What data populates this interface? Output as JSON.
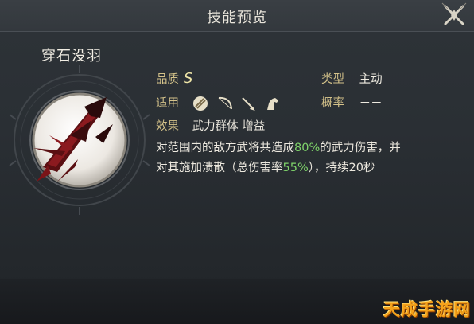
{
  "header": {
    "title": "技能预览"
  },
  "skill": {
    "name": "穿石没羽",
    "quality_label": "品质",
    "quality_value": "S",
    "type_label": "类型",
    "type_value": "主动",
    "suitable_label": "适用",
    "suitable_icons": [
      "cavalry-shield-icon",
      "bow-icon",
      "spear-icon",
      "horse-icon"
    ],
    "chance_label": "概率",
    "chance_value": "－－",
    "effect_label": "效果",
    "effect_value": "武力群体 增益",
    "desc_line1_a": "对范围内的敌方武将共造成",
    "desc_line1_pct": "80%",
    "desc_line1_b": "的武力伤害，并",
    "desc_line2_a": "对其施加溃散（总伤害率",
    "desc_line2_pct": "55%",
    "desc_line2_b": "），持续20秒"
  },
  "watermark": "天成手游网",
  "colors": {
    "highlight": "#7fd36a",
    "label_gold": "#d4c28a"
  }
}
